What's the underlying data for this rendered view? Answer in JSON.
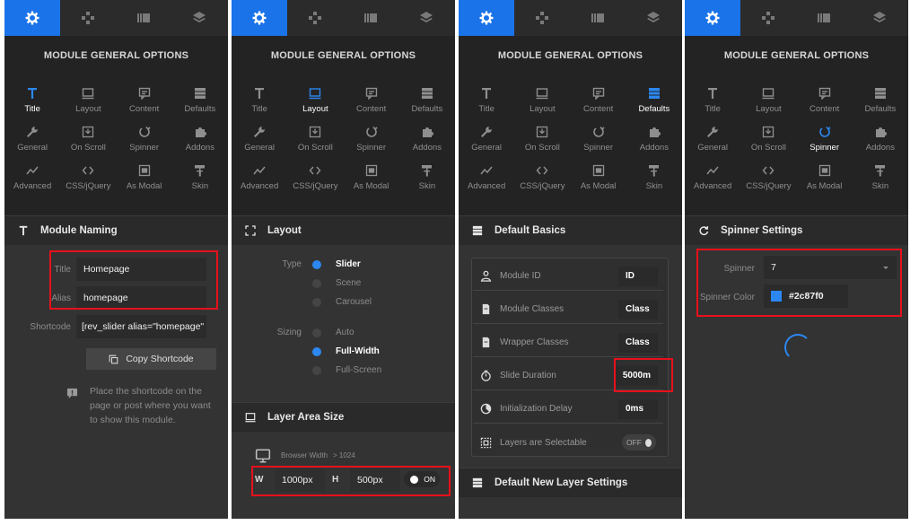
{
  "common": {
    "title": "MODULE GENERAL OPTIONS",
    "tabs": [
      "settings-icon",
      "navigation-icon",
      "slides-icon",
      "layers-icon"
    ],
    "grid": [
      {
        "icon": "title-icon",
        "label": "Title"
      },
      {
        "icon": "layout-icon",
        "label": "Layout"
      },
      {
        "icon": "content-icon",
        "label": "Content"
      },
      {
        "icon": "defaults-icon",
        "label": "Defaults"
      },
      {
        "icon": "wrench-icon",
        "label": "General"
      },
      {
        "icon": "on-scroll-icon",
        "label": "On Scroll"
      },
      {
        "icon": "spinner-icon",
        "label": "Spinner"
      },
      {
        "icon": "puzzle-icon",
        "label": "Addons"
      },
      {
        "icon": "chart-icon",
        "label": "Advanced"
      },
      {
        "icon": "code-icon",
        "label": "CSS/jQuery"
      },
      {
        "icon": "modal-icon",
        "label": "As Modal"
      },
      {
        "icon": "paint-roller-icon",
        "label": "Skin"
      }
    ],
    "accent": "#2c87f0",
    "highlight": "#e8101b"
  },
  "panel1": {
    "section": "Module Naming",
    "title_label": "Title",
    "title_value": "Homepage",
    "alias_label": "Alias",
    "alias_value": "homepage",
    "shortcode_label": "Shortcode",
    "shortcode_value": "[rev_slider alias=\"homepage\"",
    "copy_button": "Copy Shortcode",
    "hint": "Place the shortcode on the page or post where you want to show this module."
  },
  "panel2": {
    "section": "Layout",
    "type_label": "Type",
    "type_options": [
      "Slider",
      "Scene",
      "Carousel"
    ],
    "sizing_label": "Sizing",
    "sizing_options": [
      "Auto",
      "Full-Width",
      "Full-Screen"
    ],
    "area_section": "Layer Area Size",
    "browser_width": "Browser Width",
    "browser_width_value": "> 1024",
    "w_label": "W",
    "w_value": "1000px",
    "h_label": "H",
    "h_value": "500px",
    "toggle": "ON"
  },
  "panel3": {
    "section": "Default Basics",
    "rows": [
      {
        "icon": "module-id-icon",
        "label": "Module ID",
        "value": "ID"
      },
      {
        "icon": "module-classes-icon",
        "label": "Module Classes",
        "value": "Class"
      },
      {
        "icon": "wrapper-classes-icon",
        "label": "Wrapper Classes",
        "value": "Class"
      },
      {
        "icon": "stopwatch-icon",
        "label": "Slide Duration",
        "value": "5000m"
      },
      {
        "icon": "delay-icon",
        "label": "Initialization Delay",
        "value": "0ms"
      },
      {
        "icon": "selectable-icon",
        "label": "Layers are Selectable",
        "value": "OFF"
      }
    ],
    "footer_section": "Default New Layer Settings"
  },
  "panel4": {
    "section": "Spinner Settings",
    "spinner_label": "Spinner",
    "spinner_value": "7",
    "color_label": "Spinner Color",
    "color_value": "#2c87f0"
  }
}
